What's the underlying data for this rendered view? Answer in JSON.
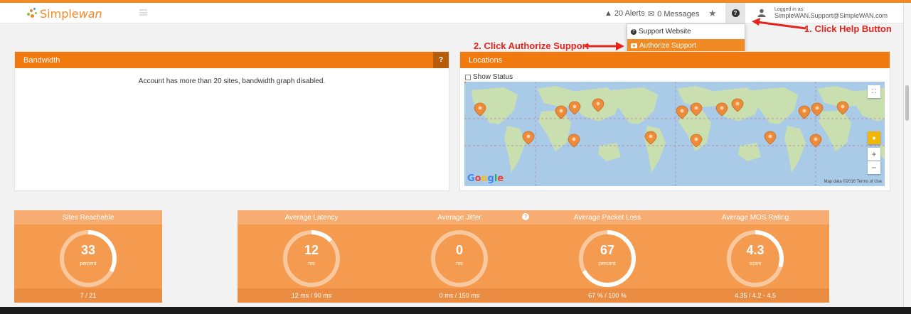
{
  "app": {
    "brand_a": "Simple",
    "brand_b": "wan"
  },
  "navbar": {
    "alerts": "20 Alerts",
    "messages": "0 Messages",
    "logged_in_label": "Logged in as:",
    "user_email": "SimpleWAN.Support@SimpleWAN.com"
  },
  "help_menu": {
    "items": [
      {
        "label": "Support Website",
        "icon": "question-circle-icon"
      },
      {
        "label": "Authorize Support",
        "icon": "camera-icon"
      }
    ]
  },
  "annotations": {
    "step1": "1. Click Help Button",
    "step2": "2. Click Authorize Support",
    "color": "#e8231c"
  },
  "bandwidth": {
    "title": "Bandwidth",
    "help": "?",
    "message": "Account has more than 20 sites, bandwidth graph disabled."
  },
  "locations": {
    "title": "Locations",
    "show_status": "Show Status",
    "map_brand": "Google",
    "map_credit": "Map data ©2016   Terms of Use",
    "zoom_in": "+",
    "zoom_out": "−"
  },
  "metrics": [
    {
      "title": "Sites Reachable",
      "value": "33",
      "unit": "percent",
      "footer": "7 / 21",
      "fraction": 0.33
    },
    {
      "title": "Average Latency",
      "value": "12",
      "unit": "ms",
      "footer": "12 ms / 90 ms",
      "fraction": 0.13
    },
    {
      "title": "Average Jitter",
      "value": "0",
      "unit": "ms",
      "footer": "0 ms / 150 ms",
      "fraction": 0.0
    },
    {
      "title": "Average Packet Loss",
      "value": "67",
      "unit": "percent",
      "footer": "67 % / 100 %",
      "fraction": 0.67
    },
    {
      "title": "Average MOS Rating",
      "value": "4.3",
      "unit": "score",
      "footer": "4.35 / 4.2 - 4.5",
      "fraction": 0.3
    }
  ],
  "colors": {
    "accent": "#f08a24",
    "panel_header": "#f07a10",
    "card": "#f59b4f"
  }
}
